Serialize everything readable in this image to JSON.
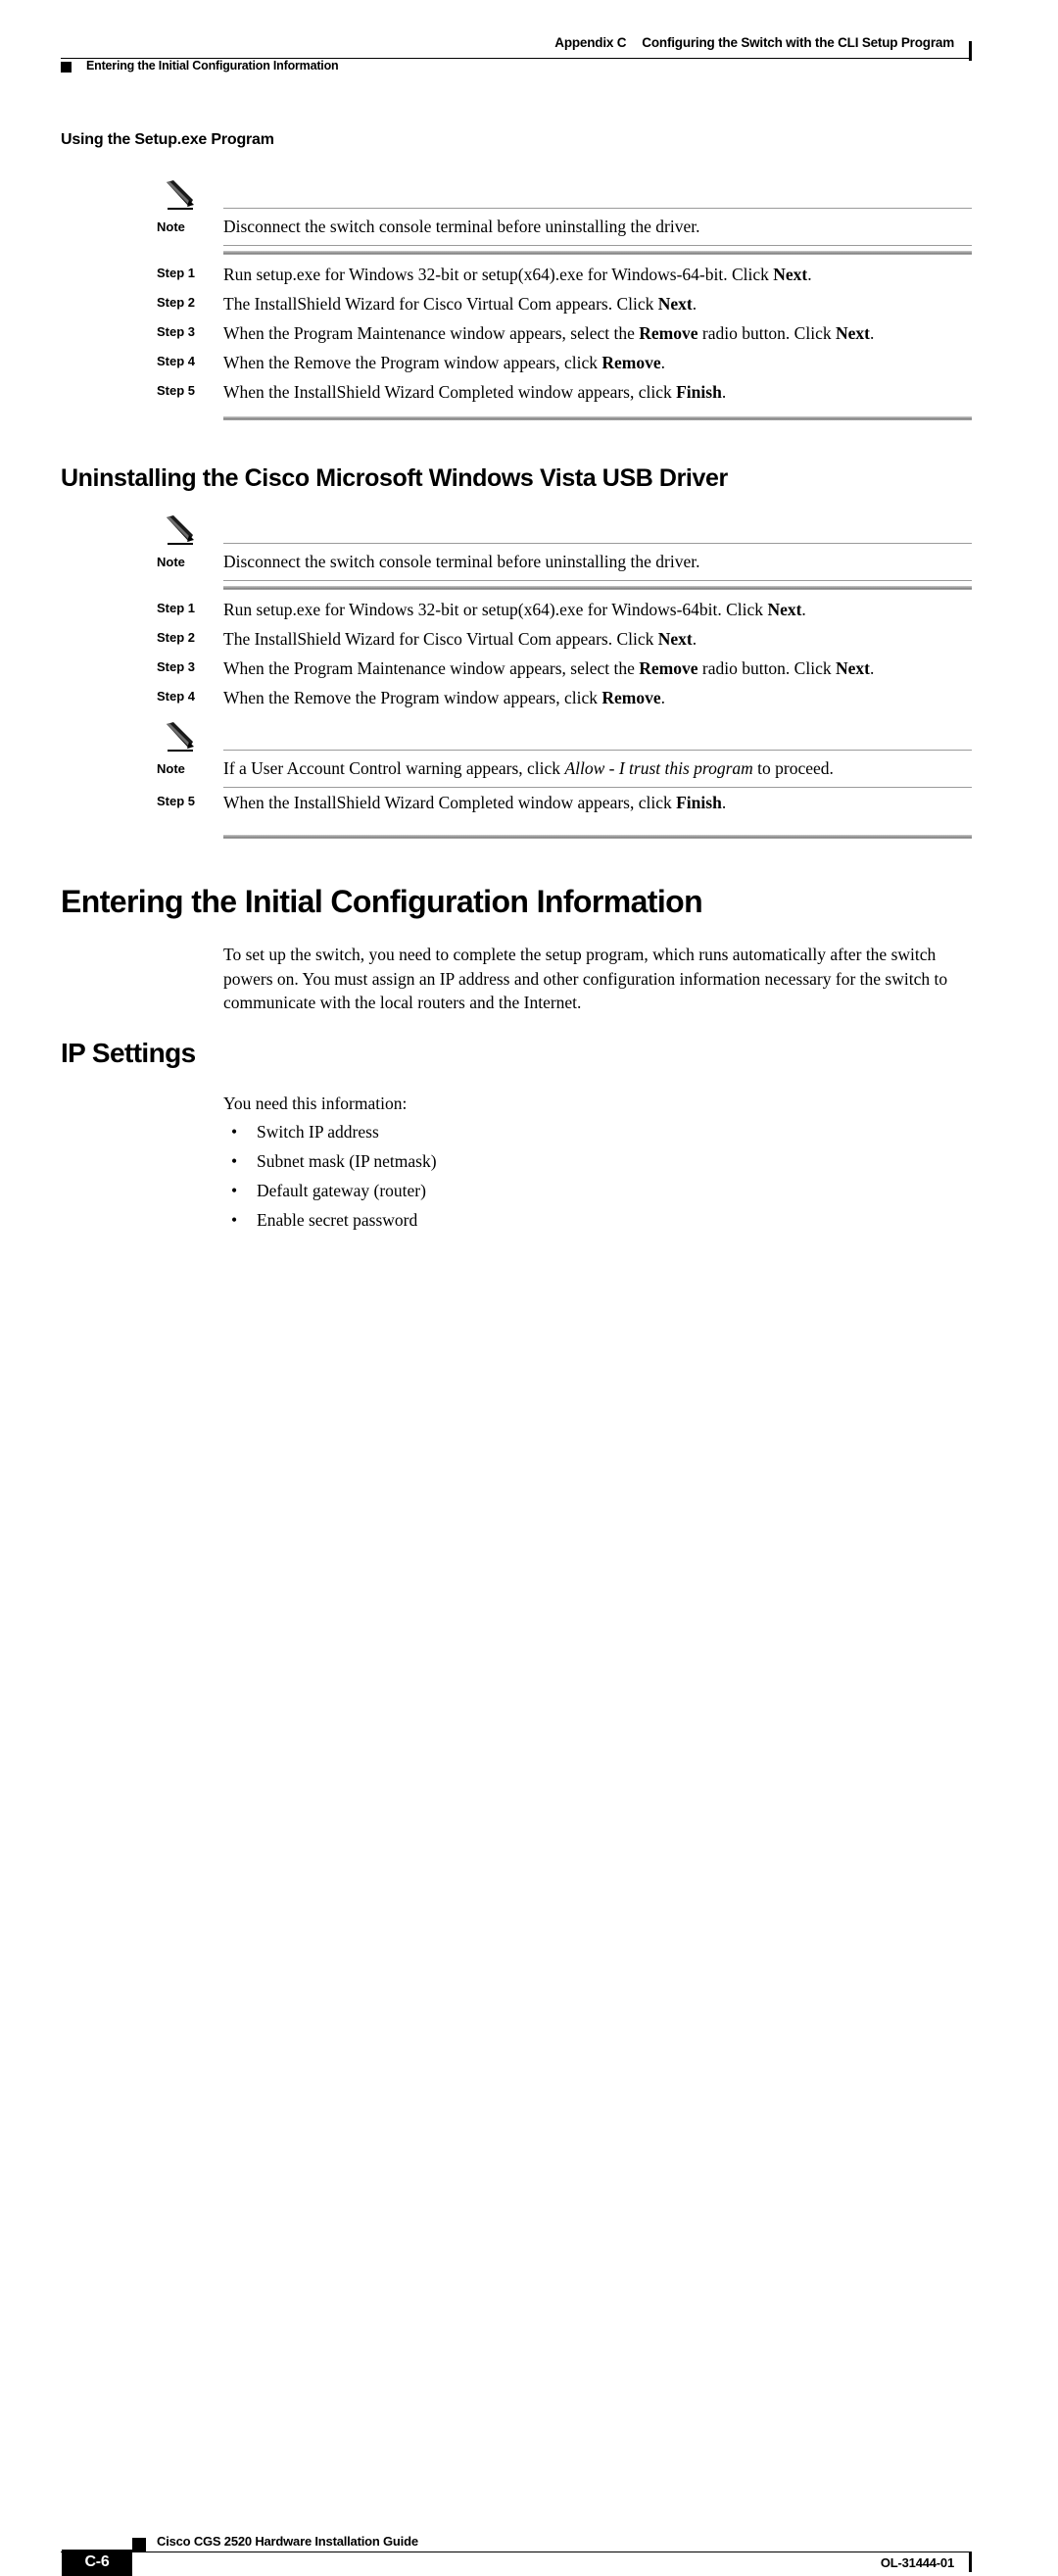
{
  "header": {
    "appendix_label": "Appendix C",
    "appendix_title": "Configuring the Switch with the CLI Setup Program",
    "running_head": "Entering the Initial Configuration Information"
  },
  "sections": {
    "setup_exe": {
      "heading": "Using the Setup.exe Program",
      "note": {
        "label": "Note",
        "text": "Disconnect the switch console terminal before uninstalling the driver."
      },
      "steps": [
        {
          "label": "Step 1",
          "text": "Run setup.exe for Windows 32-bit or setup(x64).exe for Windows-64-bit. Click ",
          "bold_tail": "Next",
          "tail": "."
        },
        {
          "label": "Step 2",
          "text": "The InstallShield Wizard for Cisco Virtual Com appears. Click ",
          "bold_tail": "Next",
          "tail": "."
        },
        {
          "label": "Step 3",
          "text": "When the Program Maintenance window appears, select the ",
          "bold_mid": "Remove",
          "mid": " radio button. Click ",
          "bold_tail": "Next",
          "tail": "."
        },
        {
          "label": "Step 4",
          "text": "When the Remove the Program window appears, click ",
          "bold_tail": "Remove",
          "tail": "."
        },
        {
          "label": "Step 5",
          "text": "When the InstallShield Wizard Completed window appears, click ",
          "bold_tail": "Finish",
          "tail": "."
        }
      ]
    },
    "vista_usb": {
      "heading": "Uninstalling the Cisco Microsoft Windows Vista USB Driver",
      "note": {
        "label": "Note",
        "text": "Disconnect the switch console terminal before uninstalling the driver."
      },
      "steps": [
        {
          "label": "Step 1",
          "text": "Run setup.exe for Windows 32-bit or setup(x64).exe for Windows-64bit. Click ",
          "bold_tail": "Next",
          "tail": "."
        },
        {
          "label": "Step 2",
          "text": "The InstallShield Wizard for Cisco Virtual Com appears. Click ",
          "bold_tail": "Next",
          "tail": "."
        },
        {
          "label": "Step 3",
          "text": "When the Program Maintenance window appears, select the ",
          "bold_mid": "Remove",
          "mid": " radio button. Click ",
          "bold_tail": "Next",
          "tail": "."
        },
        {
          "label": "Step 4",
          "text": "When the Remove the Program window appears, click ",
          "bold_tail": "Remove",
          "tail": "."
        }
      ],
      "note2": {
        "label": "Note",
        "text_lead": "If a User Account Control warning appears, click ",
        "italic": "Allow - I trust this program",
        "text_tail": " to proceed."
      },
      "final_step": {
        "label": "Step 5",
        "text": "When the InstallShield Wizard Completed window appears, click ",
        "bold_tail": "Finish",
        "tail": "."
      }
    },
    "entering_initial": {
      "heading": "Entering the Initial Configuration Information",
      "paragraph": "To set up the switch, you need to complete the setup program, which runs automatically after the switch powers on. You must assign an IP address and other configuration information necessary for the switch to communicate with the local routers and the Internet."
    },
    "ip_settings": {
      "heading": "IP Settings",
      "intro": "You need this information:",
      "bullets": [
        "Switch IP address",
        "Subnet mask (IP netmask)",
        "Default gateway (router)",
        "Enable secret password"
      ]
    }
  },
  "footer": {
    "page_number": "C-6",
    "guide_title": "Cisco CGS 2520 Hardware Installation Guide",
    "doc_id": "OL-31444-01"
  },
  "icons": {
    "note": "pencil-icon",
    "header_marker": "square-marker-icon",
    "footer_marker": "square-marker-icon",
    "change_bar": "change-bar-icon",
    "bullet": "bullet-dot-icon"
  },
  "colors": {
    "text": "#000000",
    "rule": "#9a9a9a",
    "separator": "#8d8d8d",
    "page": "#ffffff"
  }
}
